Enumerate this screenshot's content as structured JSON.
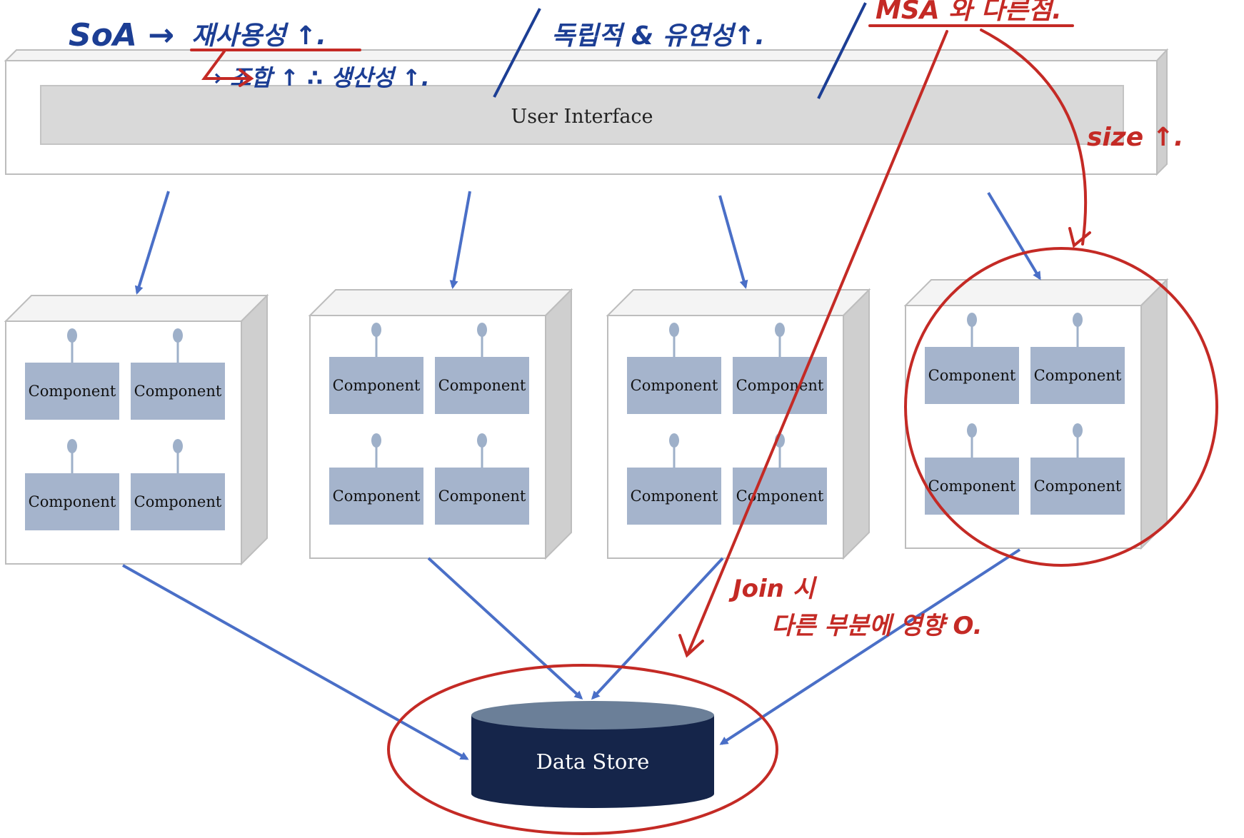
{
  "diagram": {
    "title": "",
    "user_interface_label": "User Interface",
    "data_store_label": "Data Store",
    "component_label": "Component",
    "services": [
      {
        "components": [
          "Component",
          "Component",
          "Component",
          "Component"
        ]
      },
      {
        "components": [
          "Component",
          "Component",
          "Component",
          "Component"
        ]
      },
      {
        "components": [
          "Component",
          "Component",
          "Component",
          "Component"
        ]
      },
      {
        "components": [
          "Component",
          "Component",
          "Component",
          "Component"
        ]
      }
    ]
  },
  "annotations": {
    "line1_left": "SoA →",
    "line1_right": "재사용성 ↑.",
    "line2": "→ 조합 ↑ ∴ 생산성 ↑.",
    "independence": "독립적 & 유연성↑.",
    "msa_difference": "MSA 와 다른점.",
    "size": "size ↑.",
    "join_when": "Join 시",
    "other_parts": "다른 부분에 영향 O."
  },
  "colors": {
    "box_fill": "#ffffff",
    "box_side": "#cfcfcf",
    "box_top": "#f4f4f4",
    "box_stroke": "#bdbdbd",
    "ui_bar": "#d9d9d9",
    "component": "#a5b4cc",
    "connector": "#9eb0c9",
    "arrow_blue": "#4a6fc7",
    "data_store_body": "#15254a",
    "data_store_top": "#6b7f98",
    "ink_blue": "#1c3e94",
    "ink_red": "#c42a25"
  }
}
